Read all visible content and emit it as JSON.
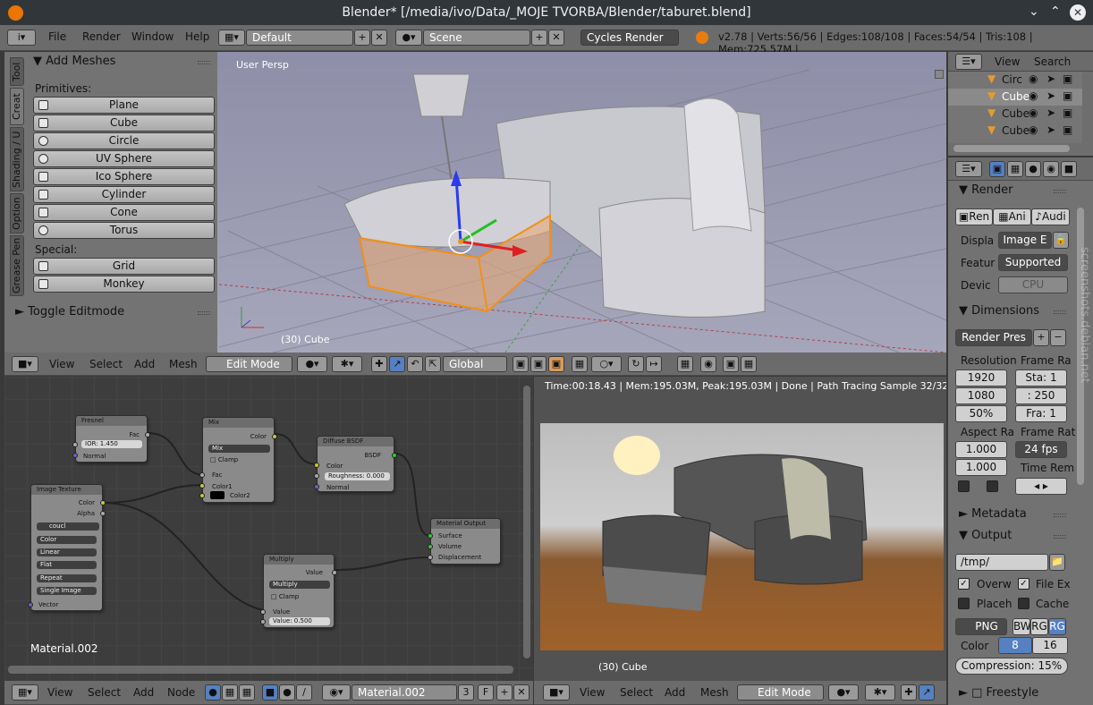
{
  "window": {
    "title": "Blender* [/media/ivo/Data/_MOJE TVORBA/Blender/taburet.blend]"
  },
  "topbar": {
    "menus": [
      "File",
      "Render",
      "Window",
      "Help"
    ],
    "layout": "Default",
    "scene": "Scene",
    "engine": "Cycles Render",
    "stats": "v2.78 | Verts:56/56 | Edges:108/108 | Faces:54/54 | Tris:108 | Mem:725.57M |"
  },
  "toolshelf": {
    "tabs": [
      "Tool",
      "Creat",
      "Shading / U",
      "Option",
      "Grease Pen"
    ],
    "section_add": "Add Meshes",
    "primitives_label": "Primitives:",
    "primitives": [
      "Plane",
      "Cube",
      "Circle",
      "UV Sphere",
      "Ico Sphere",
      "Cylinder",
      "Cone",
      "Torus"
    ],
    "special_label": "Special:",
    "special": [
      "Grid",
      "Monkey"
    ],
    "section_toggle": "Toggle Editmode"
  },
  "viewport": {
    "view_label": "User Persp",
    "object_label": "(30) Cube",
    "menus": [
      "View",
      "Select",
      "Add",
      "Mesh"
    ],
    "mode": "Edit Mode",
    "orientation": "Global"
  },
  "outliner": {
    "menus": [
      "View",
      "Search"
    ],
    "items": [
      "Circ",
      "Cube",
      "Cube",
      "Cube"
    ]
  },
  "properties": {
    "render": {
      "title": "Render",
      "buttons": [
        "Ren",
        "Ani",
        "Audi"
      ],
      "display_label": "Displa",
      "display_value": "Image E",
      "feature_label": "Featur",
      "feature_value": "Supported",
      "device_label": "Devic",
      "device_value": "CPU"
    },
    "dimensions": {
      "title": "Dimensions",
      "preset": "Render Pres",
      "resolution_label": "Resolution",
      "res_x": "1920",
      "res_y": "1080",
      "res_pct": "50%",
      "frame_range_label": "Frame Ra",
      "start": "Sta: 1",
      "end": ": 250",
      "frame": "Fra: 1",
      "aspect_label": "Aspect Ra",
      "aspect_x": "1.000",
      "aspect_y": "1.000",
      "frame_rate_label": "Frame Rat",
      "fps": "24 fps",
      "time_remap_label": "Time Rem"
    },
    "metadata": {
      "title": "Metadata"
    },
    "output": {
      "title": "Output",
      "path": "/tmp/",
      "overwrite": "Overw",
      "file_ext": "File Ex",
      "placeholders": "Placeh",
      "cache": "Cache",
      "format": "PNG",
      "bw": "BW",
      "rgb": "RG",
      "rgba": "RG",
      "color_label": "Color",
      "depth8": "8",
      "depth16": "16",
      "compression": "Compression: 15%"
    },
    "freestyle": {
      "title": "Freestyle"
    }
  },
  "node_editor": {
    "material_label": "Material.002",
    "menus": [
      "View",
      "Select",
      "Add",
      "Node"
    ],
    "material": "Material.002",
    "users": "3",
    "fake": "F",
    "nodes": {
      "fresnel": {
        "title": "Fresnel",
        "out": "Fac",
        "ior": "IOR:     1.450",
        "normal": "Normal"
      },
      "mix": {
        "title": "Mix",
        "out": "Color",
        "mode": "Mix",
        "clamp": "Clamp",
        "fac": "Fac",
        "c1": "Color1",
        "c2": "Color2"
      },
      "diffuse": {
        "title": "Diffuse BSDF",
        "out": "BSDF",
        "color": "Color",
        "rough": "Roughness: 0.000",
        "normal": "Normal"
      },
      "image": {
        "title": "Image Texture",
        "color": "Color",
        "alpha": "Alpha",
        "file": "coucl",
        "opts": [
          "Color",
          "Linear",
          "Flat",
          "Repeat",
          "Single Image"
        ],
        "vector": "Vector"
      },
      "output": {
        "title": "Material Output",
        "surface": "Surface",
        "volume": "Volume",
        "disp": "Displacement"
      },
      "multiply": {
        "title": "Multiply",
        "out": "Value",
        "mode": "Multiply",
        "clamp": "Clamp",
        "value": "Value",
        "val": "Value:    0.500"
      }
    }
  },
  "render_view": {
    "status": "Time:00:18.43 | Mem:195.03M, Peak:195.03M | Done | Path Tracing Sample 32/32",
    "object_label": "(30) Cube",
    "menus": [
      "View",
      "Select",
      "Add",
      "Mesh"
    ],
    "mode": "Edit Mode"
  },
  "watermark": "screenshots.debian.net"
}
